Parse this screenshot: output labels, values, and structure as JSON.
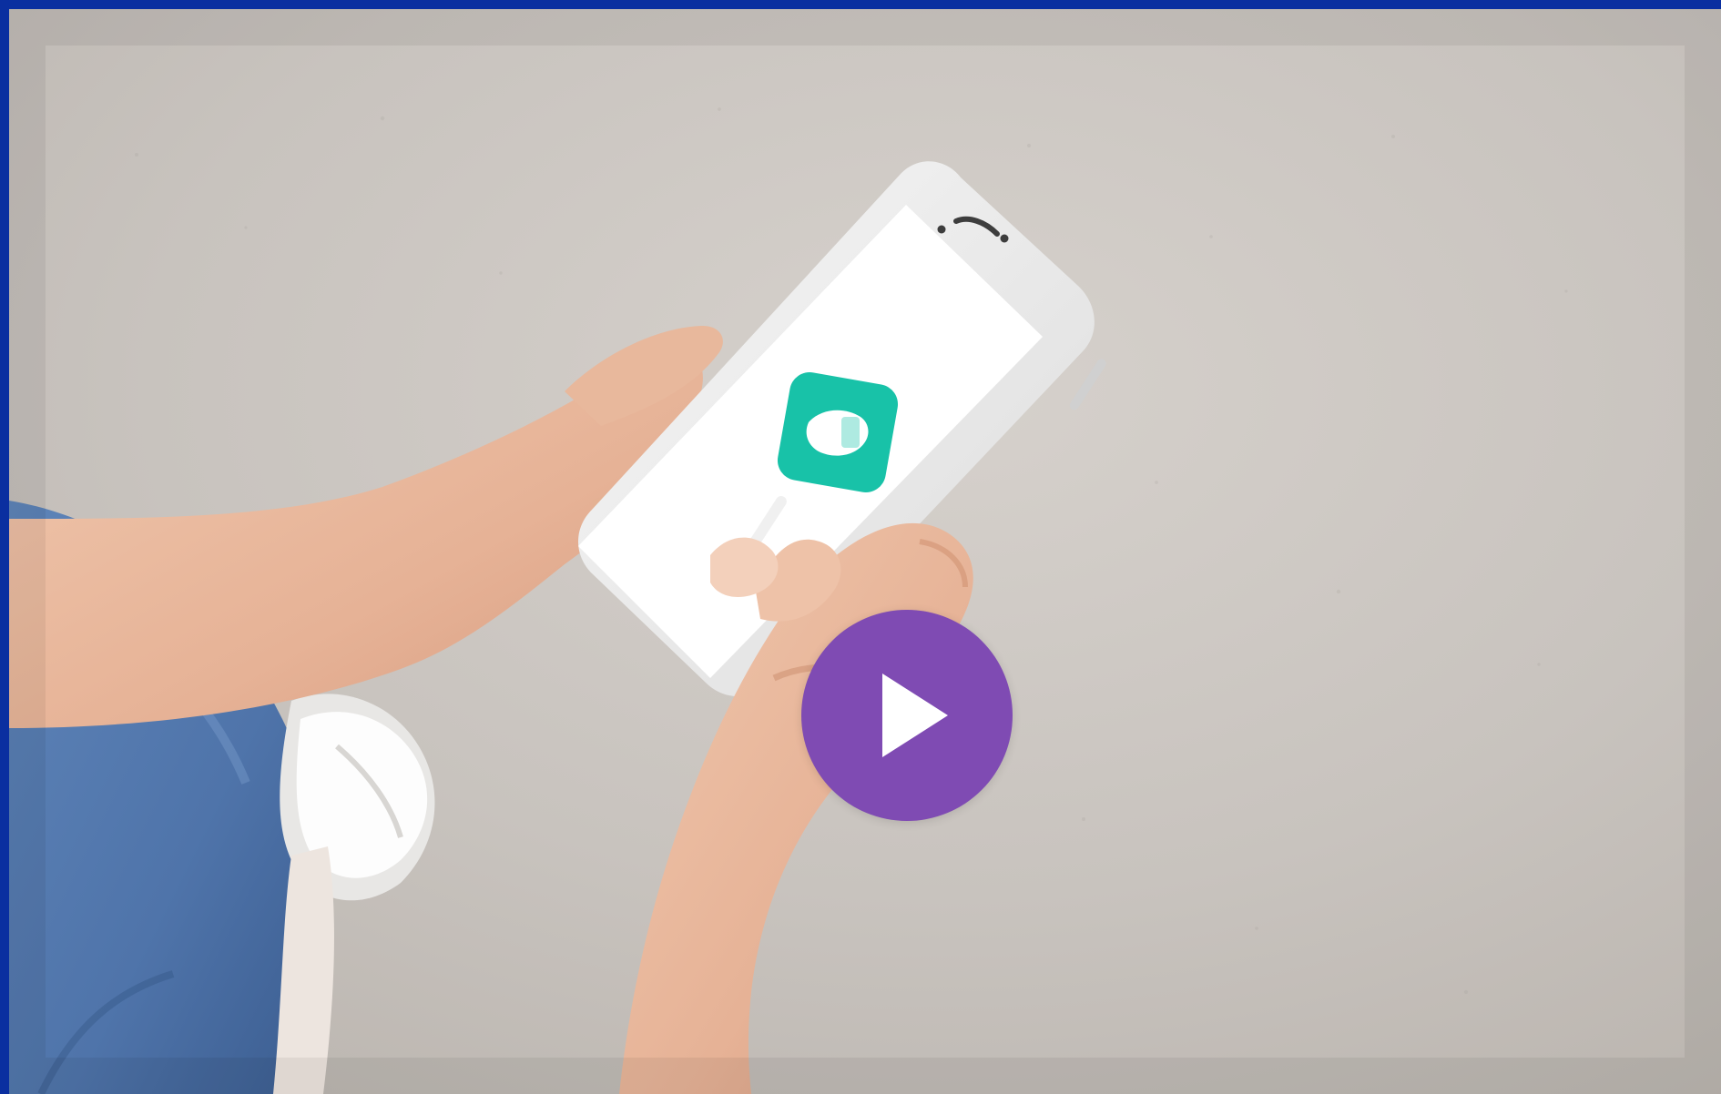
{
  "video": {
    "play_icon": "play-icon",
    "colors": {
      "frame": "#0a2fa0",
      "play_button": "#7f4bb3",
      "app_icon": "#18c2a8"
    }
  }
}
